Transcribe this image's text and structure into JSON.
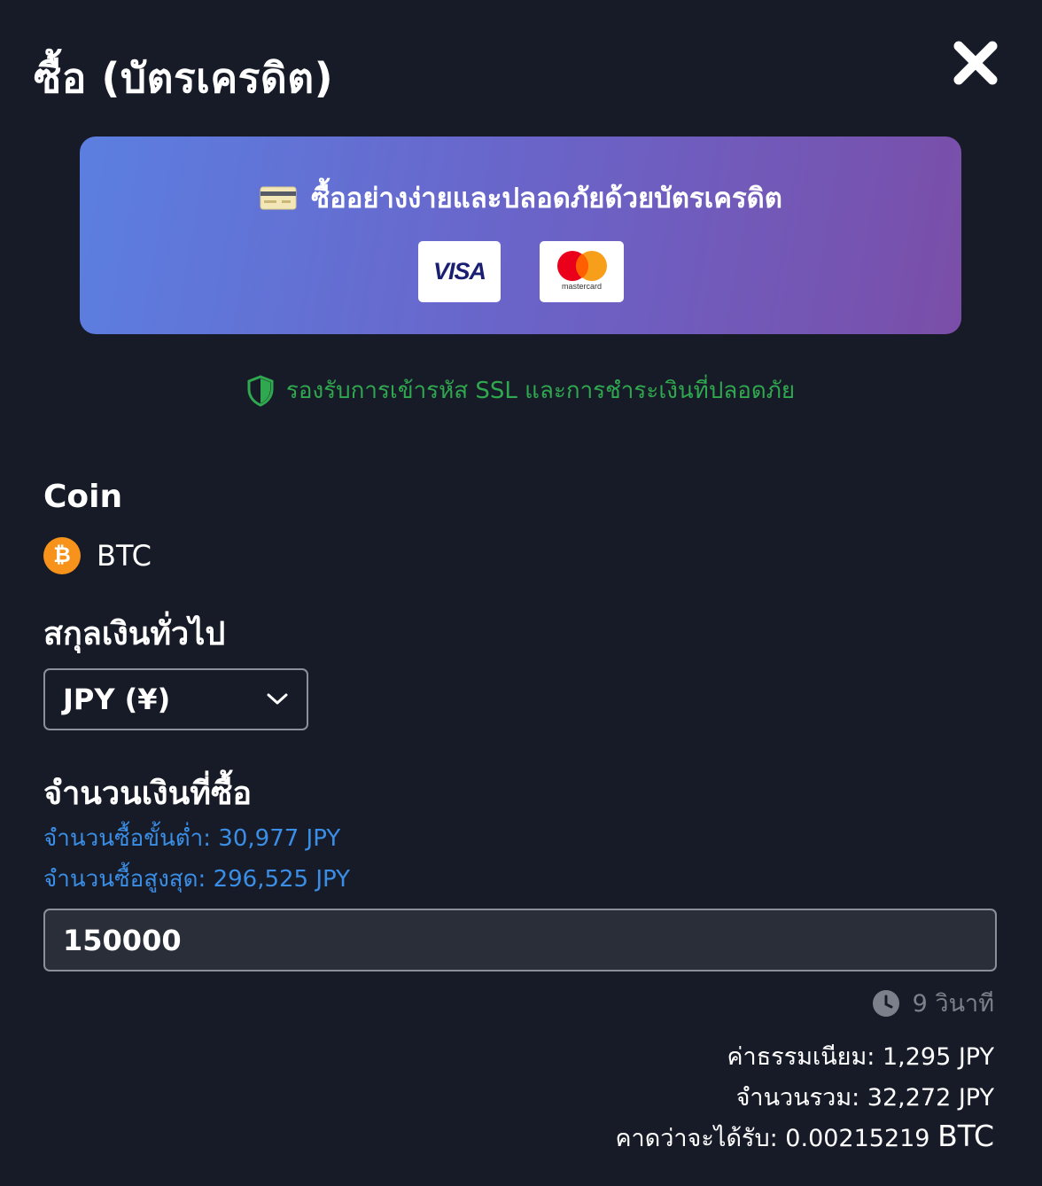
{
  "header": {
    "title": "ซื้อ (บัตรเครดิต)",
    "close_icon": "close-icon"
  },
  "banner": {
    "headline": "ซื้ออย่างง่ายและปลอดภัยด้วยบัตรเครดิต",
    "card_icon": "credit-card-icon",
    "visa_text": "VISA",
    "mastercard_text": "mastercard",
    "colors": {
      "gradient_start": "#5b7fe0",
      "gradient_end": "#7a4ea8"
    }
  },
  "security": {
    "text": "รองรับการเข้ารหัส SSL และการชำระเงินที่ปลอดภัย",
    "icon": "shield-icon",
    "color": "#2fa84f"
  },
  "coin": {
    "label": "Coin",
    "symbol": "BTC",
    "icon": "bitcoin-icon",
    "icon_color": "#f7931a"
  },
  "currency": {
    "label": "สกุลเงินทั่วไป",
    "selected": "JPY (¥)"
  },
  "amount": {
    "label": "จำนวนเงินที่ซื้อ",
    "min_text": "จำนวนซื้อขั้นต่ำ: 30,977 JPY",
    "max_text": "จำนวนซื้อสูงสุด: 296,525 JPY",
    "value": "150000",
    "limit_color": "#3a8ee6"
  },
  "timer": {
    "text": "9 วินาที",
    "icon": "clock-icon"
  },
  "summary": {
    "fee": "ค่าธรรมเนียม: 1,295 JPY",
    "total": "จำนวนรวม: 32,272 JPY",
    "expected_prefix": "คาดว่าจะได้รับ: 0.00215219",
    "expected_unit": "BTC"
  }
}
